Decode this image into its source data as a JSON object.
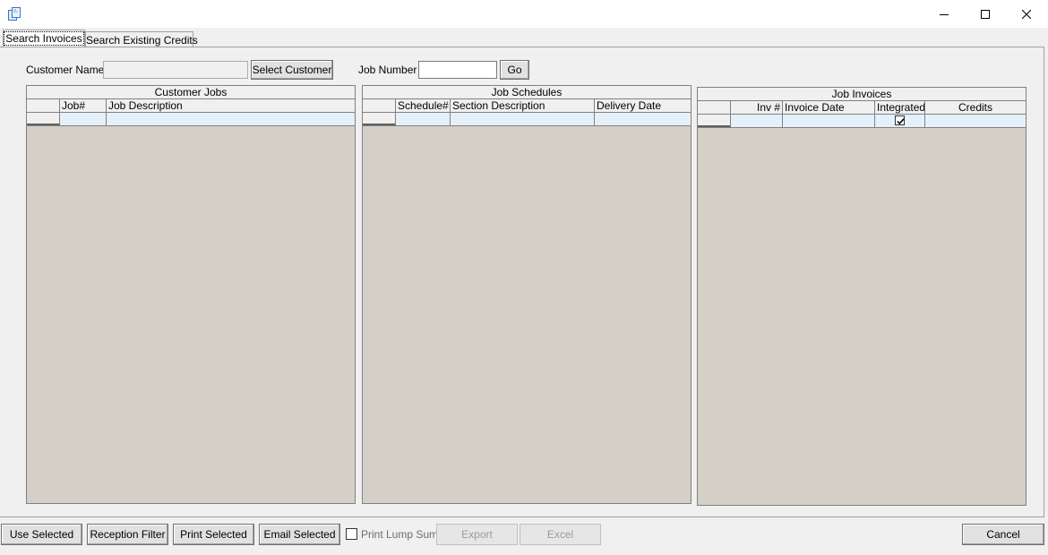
{
  "window": {
    "icon": "copy-documents-icon",
    "controls": [
      "minimize-icon",
      "maximize-icon",
      "close-icon"
    ]
  },
  "tabs": [
    {
      "label": "Search Invoices",
      "active": true
    },
    {
      "label": "Search Existing Credits",
      "active": false
    }
  ],
  "search": {
    "customer_name_label": "Customer Name :",
    "customer_name_value": "",
    "select_customer_label": "Select Customer",
    "job_number_label": "Job Number :",
    "job_number_value": "",
    "go_label": "Go"
  },
  "grids": {
    "customer_jobs": {
      "caption": "Customer Jobs",
      "columns": [
        "Job#",
        "Job Description"
      ],
      "rows": [
        [
          "",
          ""
        ]
      ]
    },
    "job_schedules": {
      "caption": "Job Schedules",
      "columns": [
        "Schedule#",
        "Section Description",
        "Delivery Date"
      ],
      "rows": [
        [
          "",
          "",
          ""
        ]
      ]
    },
    "job_invoices": {
      "caption": "Job Invoices",
      "columns": [
        "Inv #",
        "Invoice Date",
        "Integrated",
        "Credits"
      ],
      "rows": [
        {
          "inv": "",
          "date": "",
          "integrated": true,
          "credits": ""
        }
      ]
    }
  },
  "actions": {
    "use_selected": "Use Selected",
    "reception_filter": "Reception Filter",
    "print_selected": "Print Selected",
    "email_selected": "Email Selected",
    "print_lump_sum": "Print Lump Sum",
    "print_lump_sum_checked": false,
    "export": "Export",
    "excel": "Excel",
    "cancel": "Cancel"
  },
  "colors": {
    "grid_background": "#d4d0c8",
    "row_highlight": "#e6f0fa",
    "window_background": "#f0f0f0"
  }
}
